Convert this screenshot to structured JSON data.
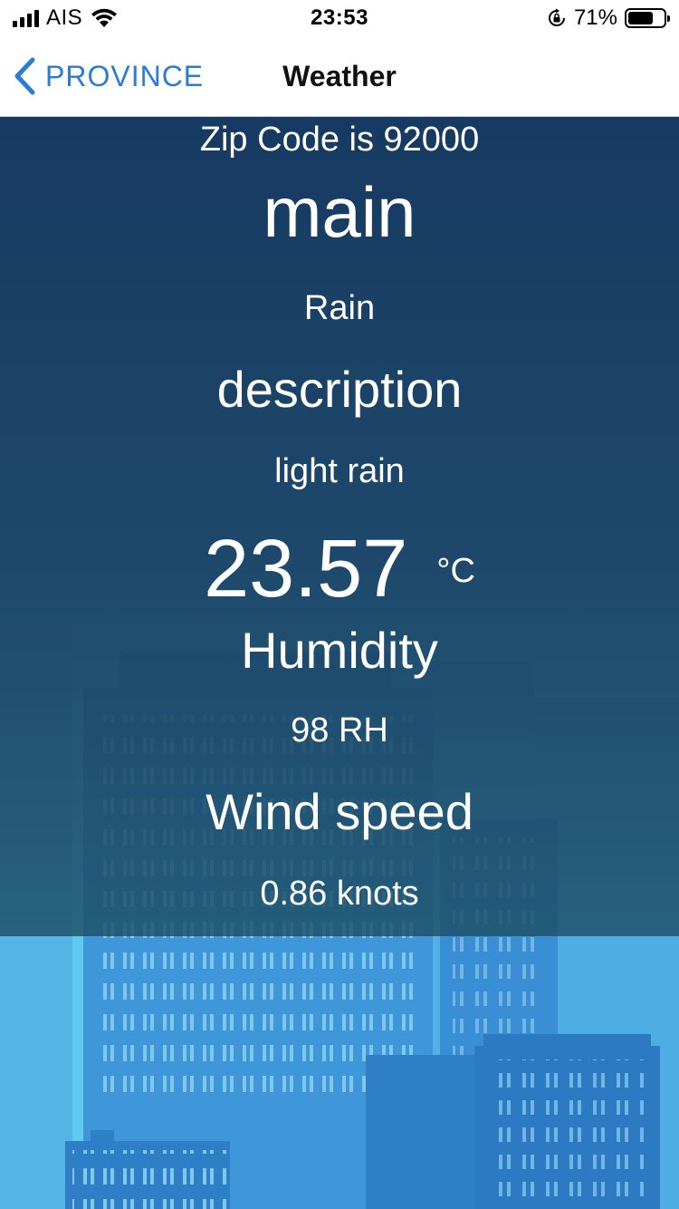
{
  "status_bar": {
    "carrier": "AIS",
    "time": "23:53",
    "battery_percent": "71%",
    "battery_level": 0.71,
    "icons": [
      "signal-icon",
      "wifi-icon",
      "orientation-lock-icon",
      "battery-icon"
    ]
  },
  "nav": {
    "back_label": "PROVINCE",
    "title": "Weather",
    "accent_color": "#2b7bd8"
  },
  "weather": {
    "zip_line": "Zip Code is 92000",
    "main_heading": "main",
    "main_value": "Rain",
    "description_heading": "description",
    "description_value": "light rain",
    "temperature": "23.57",
    "temperature_unit": "°C",
    "humidity_heading": "Humidity",
    "humidity_value": "98 RH",
    "wind_heading": "Wind speed",
    "wind_value": "0.86 knots"
  }
}
